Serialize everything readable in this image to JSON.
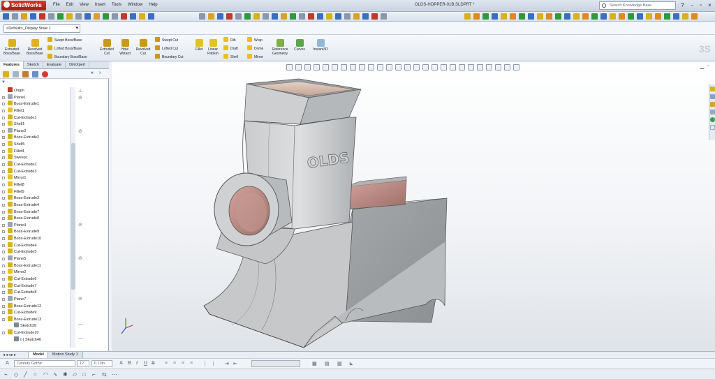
{
  "app": {
    "name": "SolidWorks"
  },
  "menu": [
    "File",
    "Edit",
    "View",
    "Insert",
    "Tools",
    "Window",
    "Help"
  ],
  "document_title": "OLDS-HOPPER-01B.SLDPRT *",
  "search": {
    "placeholder": "Search Knowledge Base"
  },
  "window_controls": [
    "?",
    "-",
    "▫",
    "×"
  ],
  "configuration": "<Default>_Display State 1",
  "ribbon": {
    "extruded_boss": "Extruded Boss/Base",
    "revolved_boss": "Revolved Boss/Base",
    "swept_boss": "Swept Boss/Base",
    "lofted_boss": "Lofted Boss/Base",
    "boundary_boss": "Boundary Boss/Base",
    "extruded_cut": "Extruded Cut",
    "hole_wizard": "Hole Wizard",
    "revolved_cut": "Revolved Cut",
    "swept_cut": "Swept Cut",
    "lofted_cut": "Lofted Cut",
    "boundary_cut": "Boundary Cut",
    "fillet": "Fillet",
    "linear_pattern": "Linear Pattern",
    "rib": "Rib",
    "draft": "Draft",
    "shell": "Shell",
    "wrap": "Wrap",
    "dome": "Dome",
    "mirror": "Mirror",
    "reference_geometry": "Reference Geometry",
    "curves": "Curves",
    "instant3d": "Instant3D"
  },
  "panel_tabs": [
    "Features",
    "Sketch",
    "Evaluate",
    "DimXpert"
  ],
  "feature_tree": [
    {
      "label": "Origin",
      "icon": "origin-icon",
      "color": "#c0392b"
    },
    {
      "label": "Plane1",
      "icon": "plane-icon",
      "color": "#9aa5b4"
    },
    {
      "label": "Boss-Extrude1",
      "icon": "boss-extrude-icon",
      "color": "#d8b219"
    },
    {
      "label": "Fillet1",
      "icon": "fillet-icon",
      "color": "#e5c21c"
    },
    {
      "label": "Cut-Extrude1",
      "icon": "cut-extrude-icon",
      "color": "#d8b219"
    },
    {
      "label": "Shell1",
      "icon": "shell-icon",
      "color": "#e5c21c"
    },
    {
      "label": "Plane3",
      "icon": "plane-icon",
      "color": "#9aa5b4"
    },
    {
      "label": "Boss-Extrude2",
      "icon": "boss-extrude-icon",
      "color": "#d8b219"
    },
    {
      "label": "Shell5",
      "icon": "shell-icon",
      "color": "#e5c21c"
    },
    {
      "label": "Fillet4",
      "icon": "fillet-icon",
      "color": "#e5c21c"
    },
    {
      "label": "Sweep1",
      "icon": "sweep-icon",
      "color": "#d8b219"
    },
    {
      "label": "Cut-Extrude2",
      "icon": "cut-extrude-icon",
      "color": "#d8b219"
    },
    {
      "label": "Cut-Extrude3",
      "icon": "cut-extrude-icon",
      "color": "#d8b219"
    },
    {
      "label": "Mirror1",
      "icon": "mirror-icon",
      "color": "#e5c21c"
    },
    {
      "label": "Fillet8",
      "icon": "fillet-icon",
      "color": "#e5c21c"
    },
    {
      "label": "Fillet9",
      "icon": "fillet-icon",
      "color": "#e5c21c"
    },
    {
      "label": "Boss-Extrude3",
      "icon": "boss-extrude-icon",
      "color": "#d8b219"
    },
    {
      "label": "Boss-Extrude4",
      "icon": "boss-extrude-icon",
      "color": "#d8b219"
    },
    {
      "label": "Boss-Extrude7",
      "icon": "boss-extrude-icon",
      "color": "#d8b219"
    },
    {
      "label": "Boss-Extrude8",
      "icon": "boss-extrude-icon",
      "color": "#d8b219"
    },
    {
      "label": "Plane4",
      "icon": "plane-icon",
      "color": "#9aa5b4"
    },
    {
      "label": "Boss-Extrude9",
      "icon": "boss-extrude-icon",
      "color": "#d8b219"
    },
    {
      "label": "Boss-Extrude10",
      "icon": "boss-extrude-icon",
      "color": "#d8b219"
    },
    {
      "label": "Cut-Extrude4",
      "icon": "cut-extrude-icon",
      "color": "#d8b219"
    },
    {
      "label": "Cut-Extrude5",
      "icon": "cut-extrude-icon",
      "color": "#d8b219"
    },
    {
      "label": "Plane5",
      "icon": "plane-icon",
      "color": "#9aa5b4"
    },
    {
      "label": "Boss-Extrude11",
      "icon": "boss-extrude-icon",
      "color": "#d8b219"
    },
    {
      "label": "Mirror2",
      "icon": "mirror-icon",
      "color": "#e5c21c"
    },
    {
      "label": "Cut-Extrude6",
      "icon": "cut-extrude-icon",
      "color": "#d8b219"
    },
    {
      "label": "Cut-Extrude7",
      "icon": "cut-extrude-icon",
      "color": "#d8b219"
    },
    {
      "label": "Cut-Extrude8",
      "icon": "cut-extrude-icon",
      "color": "#d8b219"
    },
    {
      "label": "Plane7",
      "icon": "plane-icon",
      "color": "#9aa5b4"
    },
    {
      "label": "Boss-Extrude12",
      "icon": "boss-extrude-icon",
      "color": "#d8b219"
    },
    {
      "label": "Cut-Extrude9",
      "icon": "cut-extrude-icon",
      "color": "#d8b219"
    },
    {
      "label": "Boss-Extrude13",
      "icon": "boss-extrude-icon",
      "color": "#d8b219"
    },
    {
      "label": "Sketch39",
      "icon": "sketch-icon",
      "color": "#7b8896",
      "sub": true
    },
    {
      "label": "Cut-Extrude10",
      "icon": "cut-extrude-icon",
      "color": "#d8b219"
    },
    {
      "label": "(-) Sketch40",
      "icon": "sketch-icon",
      "color": "#7b8896",
      "sub": true
    }
  ],
  "model_label": "OLDS",
  "bottom_tabs": [
    "Model",
    "Motion Study 1"
  ],
  "format": {
    "font": "Century Gothic",
    "size": "12",
    "height": "0.13in"
  },
  "colors": {
    "accent": "#c0392b",
    "feature_yellow": "#d8b219",
    "model_grey": "#a8abae",
    "model_pink": "#c9968f"
  }
}
